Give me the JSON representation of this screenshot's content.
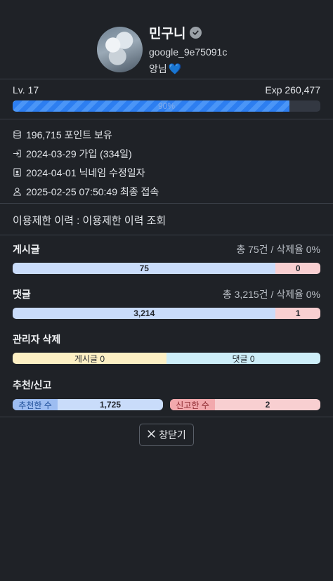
{
  "profile": {
    "name": "민구니",
    "userid": "google_9e75091c",
    "bio": "앙님",
    "bio_emoji": "💙",
    "verified_icon": "check-circle-icon"
  },
  "level": {
    "label": "Lv. 17",
    "exp": "Exp 260,477",
    "percent_label": "90%",
    "progress": 0.9
  },
  "info": [
    {
      "icon": "coins-icon",
      "text": "196,715 포인트 보유"
    },
    {
      "icon": "sign-in-icon",
      "text": "2024-03-29 가입 (334일)"
    },
    {
      "icon": "id-card-icon",
      "text": "2024-04-01 닉네임 수정일자"
    },
    {
      "icon": "user-icon",
      "text": "2025-02-25 07:50:49 최종 접속"
    }
  ],
  "restriction": {
    "text": "이용제한 이력 : 이용제한 이력 조회"
  },
  "posts": {
    "title": "게시글",
    "meta": "총 75건 / 삭제율 0%",
    "kept": "75",
    "deleted": "0",
    "kept_share": 0.855
  },
  "comments": {
    "title": "댓글",
    "meta": "총 3,215건 / 삭제율 0%",
    "kept": "3,214",
    "deleted": "1",
    "kept_share": 0.855
  },
  "admin_delete": {
    "title": "관리자 삭제",
    "posts": "게시글 0",
    "comments": "댓글 0"
  },
  "votes": {
    "title": "추천/신고",
    "recommend_label": "추천한 수",
    "recommend_value": "1,725",
    "report_label": "신고한 수",
    "report_value": "2"
  },
  "close_button": {
    "label": "창닫기",
    "icon": "close-icon"
  },
  "colors": {
    "background": "#1f2227",
    "progress": "#2d7ef0",
    "blue_segment": "#c9dcfa",
    "red_segment": "#f8cfd1",
    "yellow_segment": "#fdf0c4",
    "cyan_segment": "#cdeef8"
  }
}
